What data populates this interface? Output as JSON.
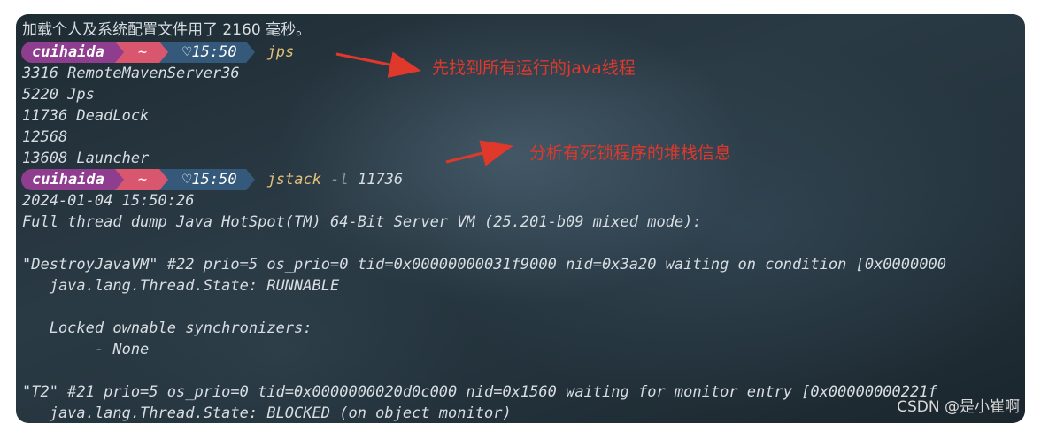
{
  "terminal": {
    "lines": {
      "load_msg": "加载个人及系统配置文件用了 2160 毫秒。",
      "pid1": "3316 RemoteMavenServer36",
      "pid2": "5220 Jps",
      "pid3": "11736 DeadLock",
      "pid4": "12568",
      "pid5": "13608 Launcher",
      "date": "2024-01-04 15:50:26",
      "dump_header": "Full thread dump Java HotSpot(TM) 64-Bit Server VM (25.201-b09 mixed mode):",
      "t1_header": "\"DestroyJavaVM\" #22 prio=5 os_prio=0 tid=0x00000000031f9000 nid=0x3a20 waiting on condition [0x0000000",
      "t1_state": "   java.lang.Thread.State: RUNNABLE",
      "t1_locked": "   Locked ownable synchronizers:",
      "t1_none": "        - None",
      "t2_header": "\"T2\" #21 prio=5 os_prio=0 tid=0x0000000020d0c000 nid=0x1560 waiting for monitor entry [0x00000000221f",
      "t2_state": "   java.lang.Thread.State: BLOCKED (on object monitor)"
    },
    "prompt1": {
      "user": "cuihaida",
      "dir": "~",
      "time": "♡15:50",
      "cmd": "jps",
      "flag": "",
      "arg": ""
    },
    "prompt2": {
      "user": "cuihaida",
      "dir": "~",
      "time": "♡15:50",
      "cmd": "jstack",
      "flag": "-l",
      "arg": "11736"
    },
    "colors": {
      "user_bg": "#8e3d8f",
      "dir_bg": "#d9566f",
      "time_bg": "#34597a",
      "command": "#e3c07a",
      "annotation": "#e0382a"
    }
  },
  "annotations": {
    "a1": "先找到所有运行的java线程",
    "a2": "分析有死锁程序的堆栈信息"
  },
  "watermark": "CSDN @是小崔啊"
}
